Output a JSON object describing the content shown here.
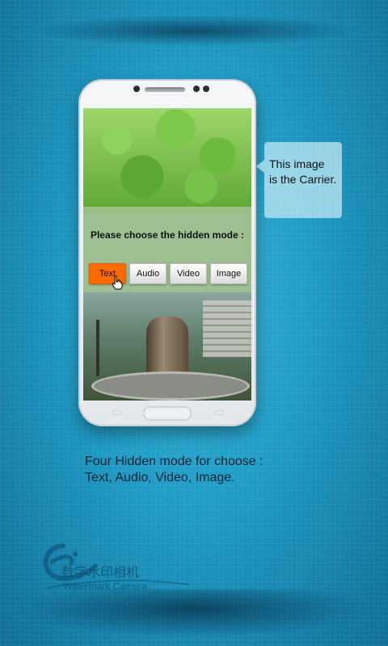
{
  "phone_screen": {
    "prompt": "Please choose the hidden mode :",
    "modes": [
      {
        "label": "Text",
        "active": true
      },
      {
        "label": "Audio",
        "active": false
      },
      {
        "label": "Video",
        "active": false
      },
      {
        "label": "Image",
        "active": false
      }
    ]
  },
  "callout": {
    "text_line1": "This image",
    "text_line2": "is the Carrier."
  },
  "caption": {
    "line1": "Four Hidden mode for choose :",
    "line2": "Text, Audio, Video, Image."
  },
  "brand": {
    "name_cn": "数字水印相机",
    "name_en": "Watermark Camera",
    "logo_icon": "e-logo-icon"
  },
  "colors": {
    "accent": "#ff6a00",
    "background": "#1d9ac4"
  }
}
